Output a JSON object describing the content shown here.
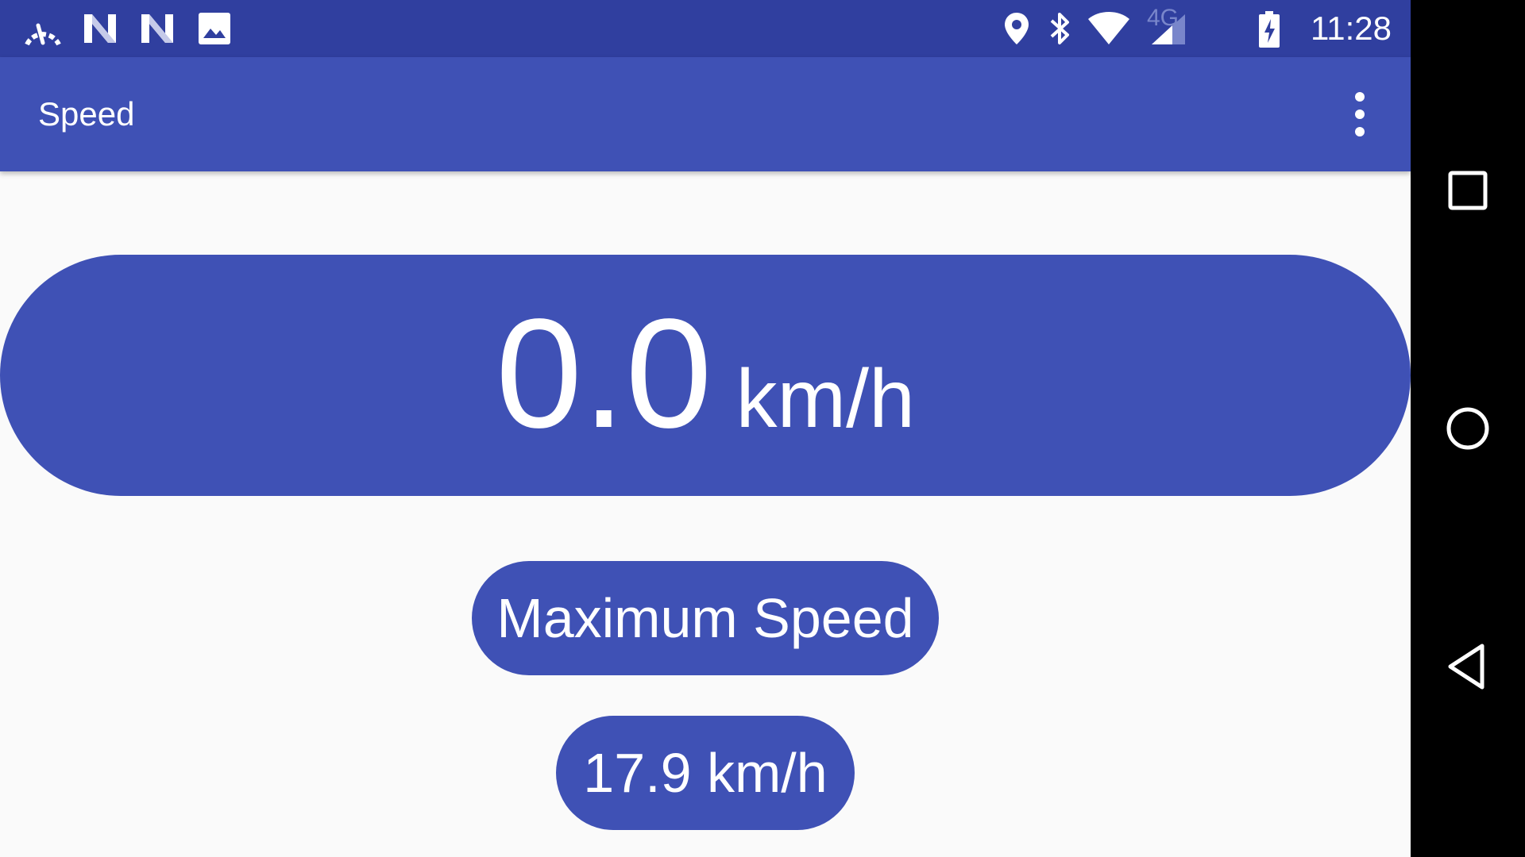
{
  "status_bar": {
    "time": "11:28",
    "network_label": "4G",
    "background_color": "#303f9f",
    "left_icons": [
      "speedometer-icon",
      "n-notification-icon",
      "n-notification-icon",
      "image-icon"
    ],
    "right_icons": [
      "location-pin-icon",
      "bluetooth-icon",
      "wifi-icon",
      "cell-signal-icon",
      "battery-charging-icon"
    ]
  },
  "app_bar": {
    "title": "Speed",
    "background_color": "#3f51b5",
    "menu_icon": "overflow-menu-icon"
  },
  "speed": {
    "value": "0.0",
    "unit": "km/h"
  },
  "max_speed": {
    "label": "Maximum Speed",
    "value": "17.9 km/h"
  },
  "nav_bar": {
    "buttons": [
      "recents-icon",
      "home-icon",
      "back-icon"
    ]
  },
  "colors": {
    "primary": "#3f51b5",
    "primary_dark": "#303f9f",
    "background": "#fafafa",
    "text_on_primary": "#ffffff"
  }
}
